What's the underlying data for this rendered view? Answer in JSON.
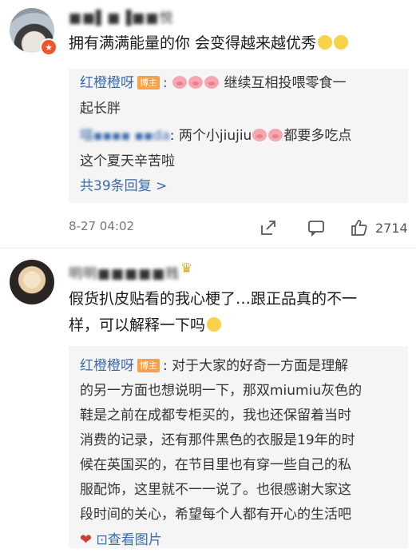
{
  "comments": [
    {
      "username": "■■▌■▐■■悦",
      "text": "拥有满满能量的你 会变得越来越优秀",
      "reply1": {
        "name": "红橙橙呀",
        "badge": "博主",
        "text_a": "继续互相投喂零食一",
        "text_b": "起长胖"
      },
      "reply2": {
        "name": "喵▪▪▪▪ ▪▪da",
        "text_a": ": 两个小jiujiu",
        "text_b": "都要多吃点",
        "text_c": "这个夏天辛苦啦"
      },
      "more_replies": "共39条回复 >",
      "timestamp": "8-27 04:02",
      "like_count": "2714"
    },
    {
      "username": "明明■■■■■贱",
      "text_a": "假货扒皮贴看的我心梗了…跟正品真的不一",
      "text_b": "样，可以解释一下吗",
      "reply1": {
        "name": "红橙橙呀",
        "badge": "博主",
        "line1": ": 对于大家的好奇一方面是理解",
        "line2": "的另一方面也想说明一下，那双miumiu灰色的",
        "line3": "鞋是之前在成都专柜买的，我也还保留着当时",
        "line4": "消费的记录，还有那件黑色的衣服是19年的时",
        "line5": "候在英国买的，在节目里也有穿一些自己的私",
        "line6": "服配饰，这里就不一一说了。也很感谢大家这",
        "line7": "段时间的关心，希望每个人都有开心的生活吧",
        "view_image": "⊡查看图片"
      }
    }
  ]
}
